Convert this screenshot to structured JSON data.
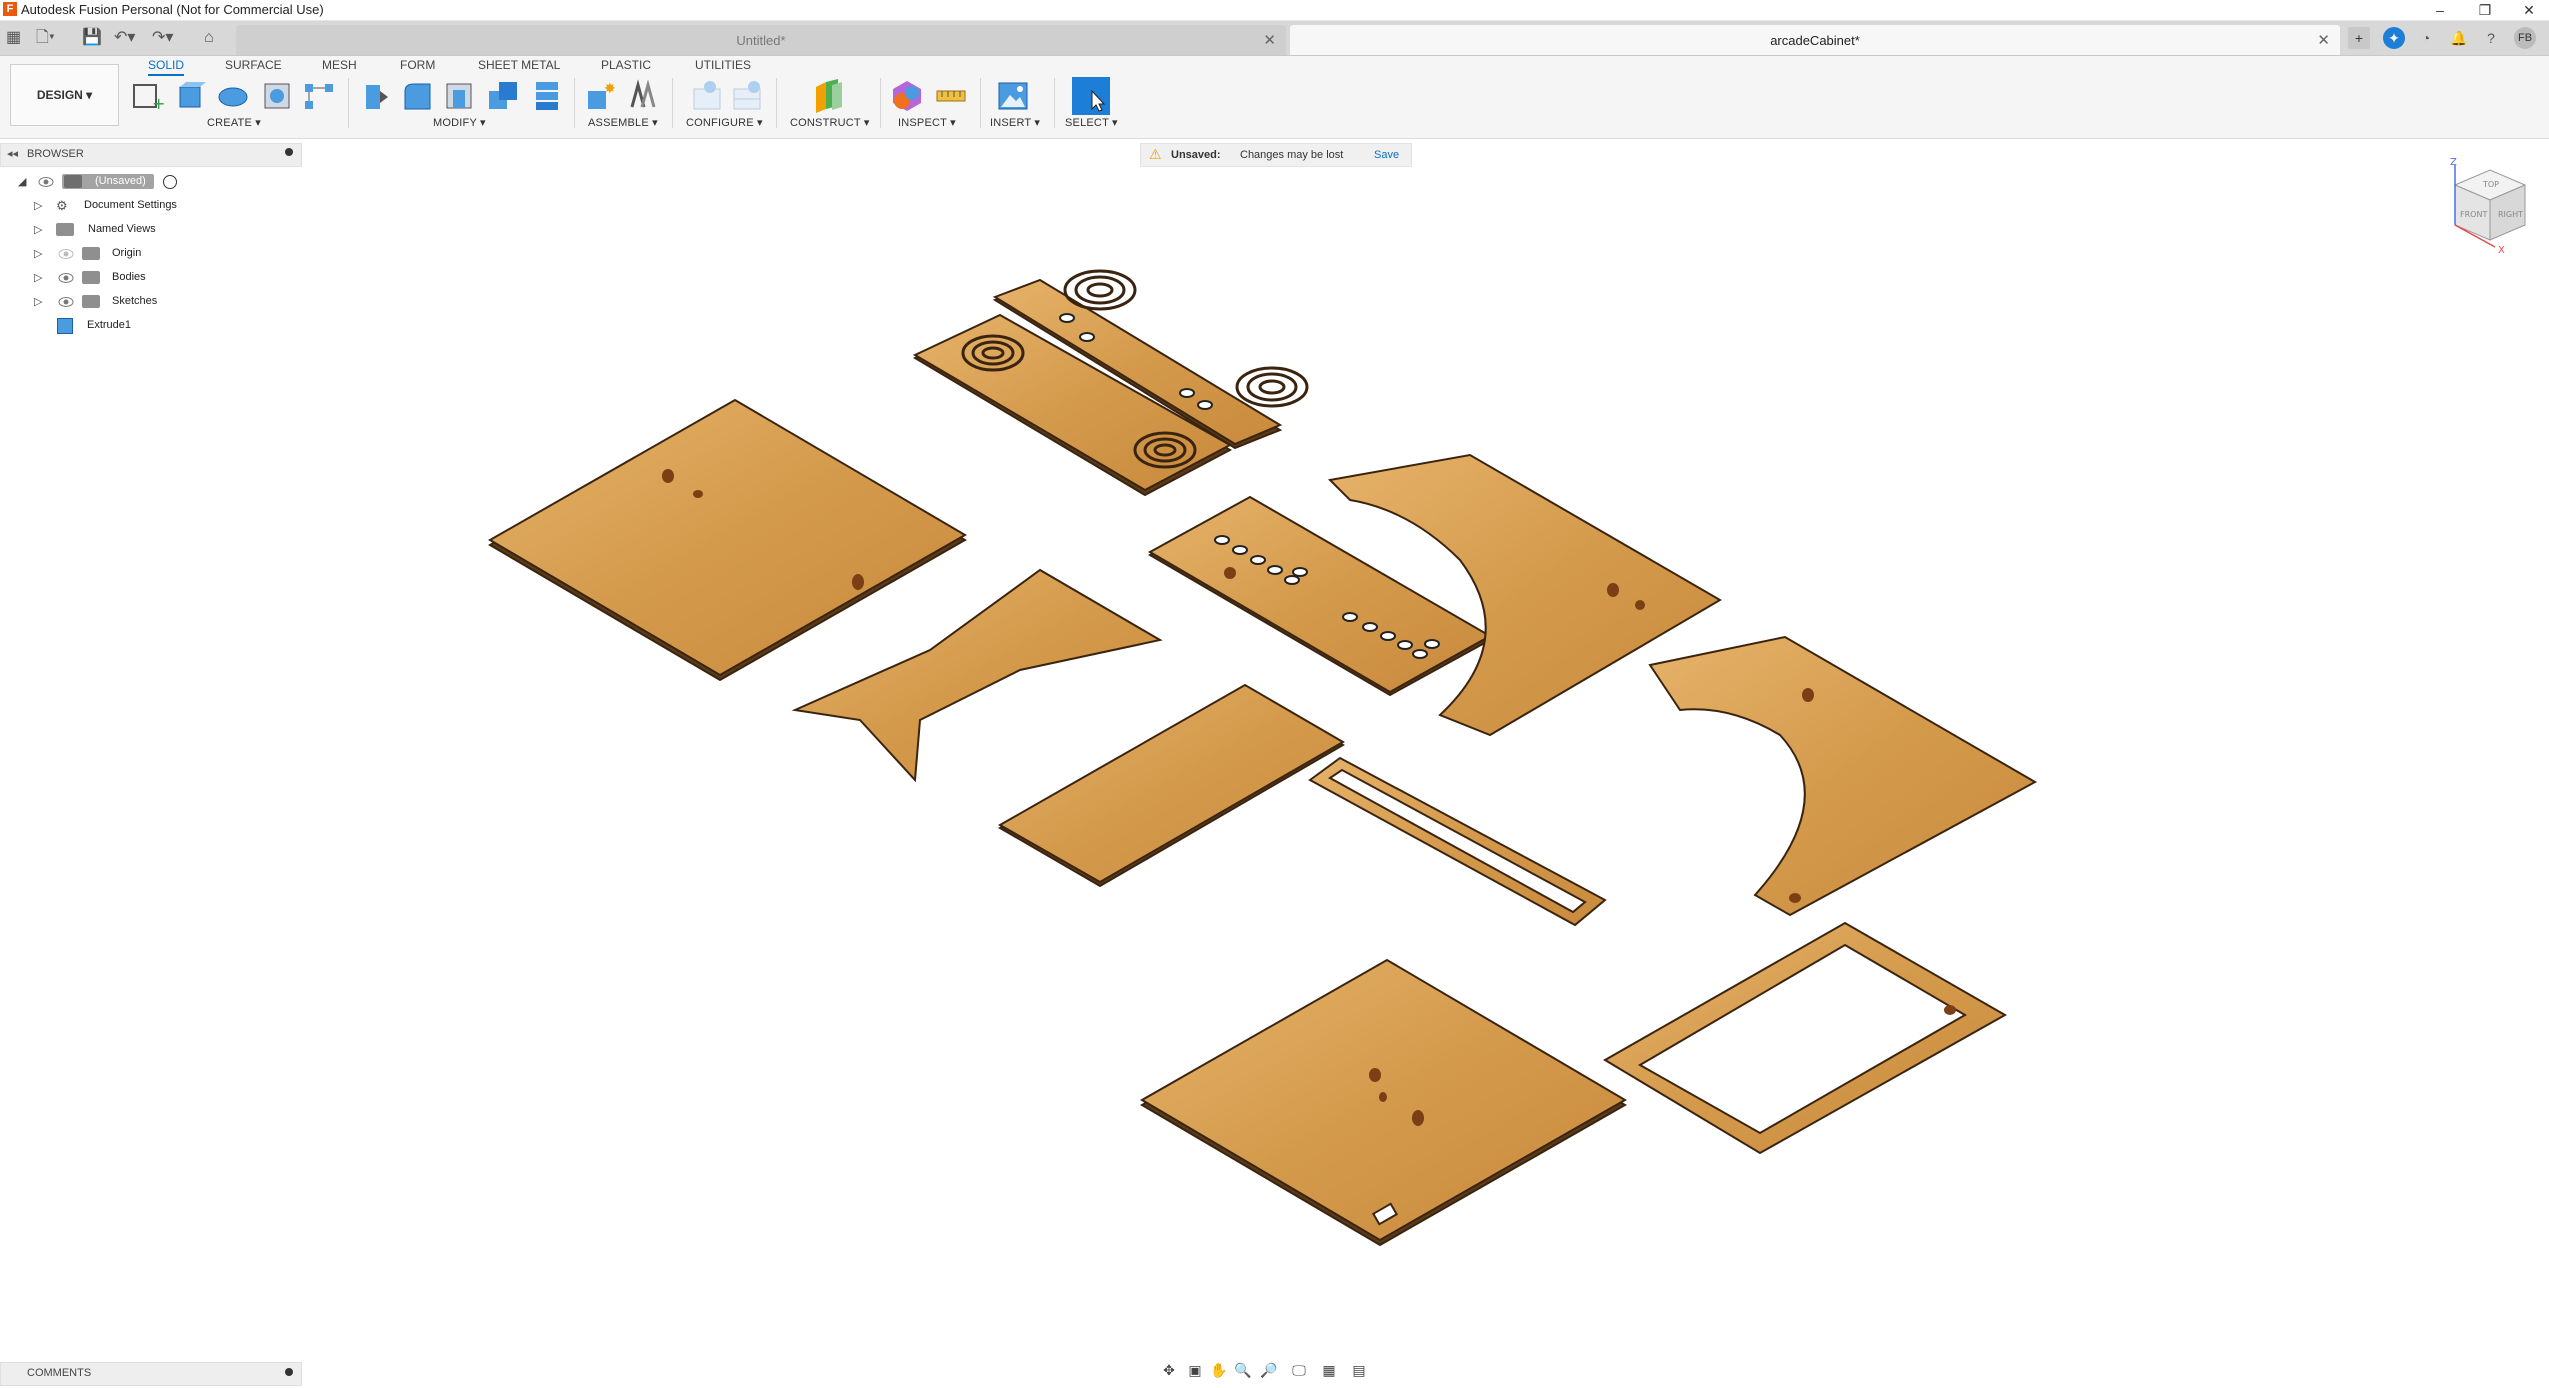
{
  "window": {
    "title": "Autodesk Fusion Personal (Not for Commercial Use)",
    "controls": [
      "–",
      "❐",
      "✕"
    ]
  },
  "tabs": [
    {
      "label": "Untitled*",
      "active": false
    },
    {
      "label": "arcadeCabinet*",
      "active": true
    }
  ],
  "user_initials": "FB",
  "toolbar": {
    "workspace_label": "DESIGN ▾",
    "tabs": [
      "SOLID",
      "SURFACE",
      "MESH",
      "FORM",
      "SHEET METAL",
      "PLASTIC",
      "UTILITIES"
    ],
    "active_tab": "SOLID",
    "groups": [
      "CREATE ▾",
      "MODIFY ▾",
      "ASSEMBLE ▾",
      "CONFIGURE ▾",
      "CONSTRUCT ▾",
      "INSPECT ▾",
      "INSERT ▾",
      "SELECT ▾"
    ]
  },
  "browser": {
    "header": "BROWSER",
    "root": "(Unsaved)",
    "items": [
      "Document Settings",
      "Named Views",
      "Origin",
      "Bodies",
      "Sketches",
      "Extrude1"
    ]
  },
  "notice": {
    "status": "Unsaved:",
    "message": "Changes may be lost",
    "action": "Save"
  },
  "comments_label": "COMMENTS",
  "viewcube": {
    "top": "TOP",
    "front": "FRONT",
    "right": "RIGHT",
    "axis_z": "Z",
    "axis_x": "X"
  },
  "colors": {
    "accent": "#0a6fc6",
    "wood_light": "#d9a35a",
    "wood_dark": "#a86a28",
    "warning": "#f0a000"
  },
  "icons": {
    "grid": "app-grid-icon",
    "file": "file-icon",
    "save": "save-icon",
    "undo": "undo-icon",
    "redo": "redo-icon",
    "home": "home-icon"
  }
}
